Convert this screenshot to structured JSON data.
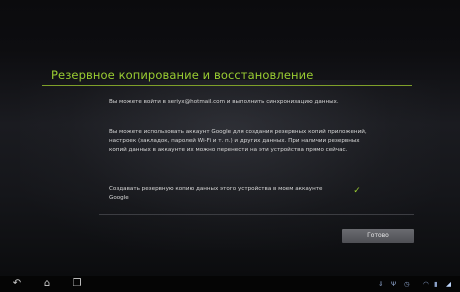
{
  "dialog": {
    "title": "Резервное копирование и восстановление",
    "paragraph1": "Вы можете войти в seriyx@hotmail.com и выполнить синхронизацию данных.",
    "paragraph2": "Вы можете использовать аккаунт Google для создания резервных копий приложений, настроек (закладок, паролей Wi-Fi и т. п.) и других данных. При наличии резервных копий данных в аккаунте их можно перенести на эти устройства прямо сейчас.",
    "checkbox_label": "Создавать резервную копию данных этого устройства в моем аккаунте Google",
    "checkbox_checked": true,
    "done_button": "Готово"
  },
  "navbar": {
    "back_icon": "back-arrow-icon",
    "home_icon": "home-icon",
    "recent_icon": "recent-apps-icon"
  },
  "status_bar": {
    "icons": [
      "download-icon",
      "usb-icon",
      "clock-icon",
      "wifi-icon",
      "battery-icon",
      "signal-icon"
    ]
  },
  "colors": {
    "accent": "#9acd32",
    "background": "#15161a"
  }
}
